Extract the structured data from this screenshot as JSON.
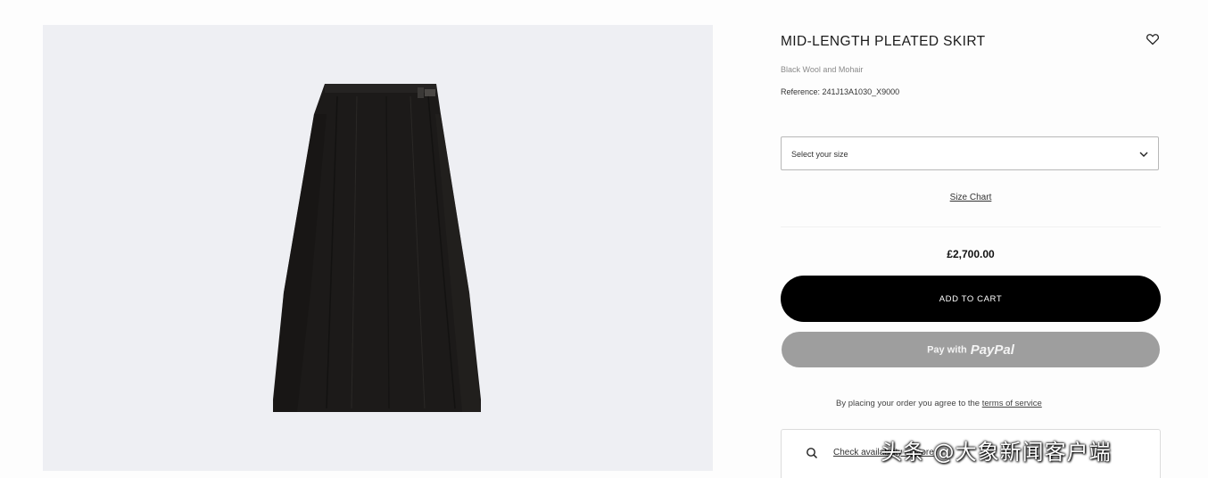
{
  "product": {
    "title": "MID-LENGTH PLEATED SKIRT",
    "subtitle": "Black Wool and Mohair",
    "reference": "Reference: 241J13A1030_X9000",
    "image_alt_icon": "skirt-product-image"
  },
  "size": {
    "placeholder": "Select your size",
    "chart_link": "Size Chart"
  },
  "price": "£2,700.00",
  "actions": {
    "add_to_cart": "ADD TO CART",
    "paypal_prefix": "Pay with",
    "paypal_brand": "PayPal"
  },
  "terms": {
    "text": "By placing your order you agree to the ",
    "link": "terms of service"
  },
  "store": {
    "link": "Check availability in store"
  },
  "icons": {
    "wishlist": "heart-icon",
    "select": "chevron-down-icon",
    "store": "search-icon"
  },
  "colors": {
    "image_background": "#eeeff3",
    "primary_button": "#000000",
    "paypal_button": "#9e9e9e"
  },
  "watermark": "头条 @大象新闻客户端"
}
